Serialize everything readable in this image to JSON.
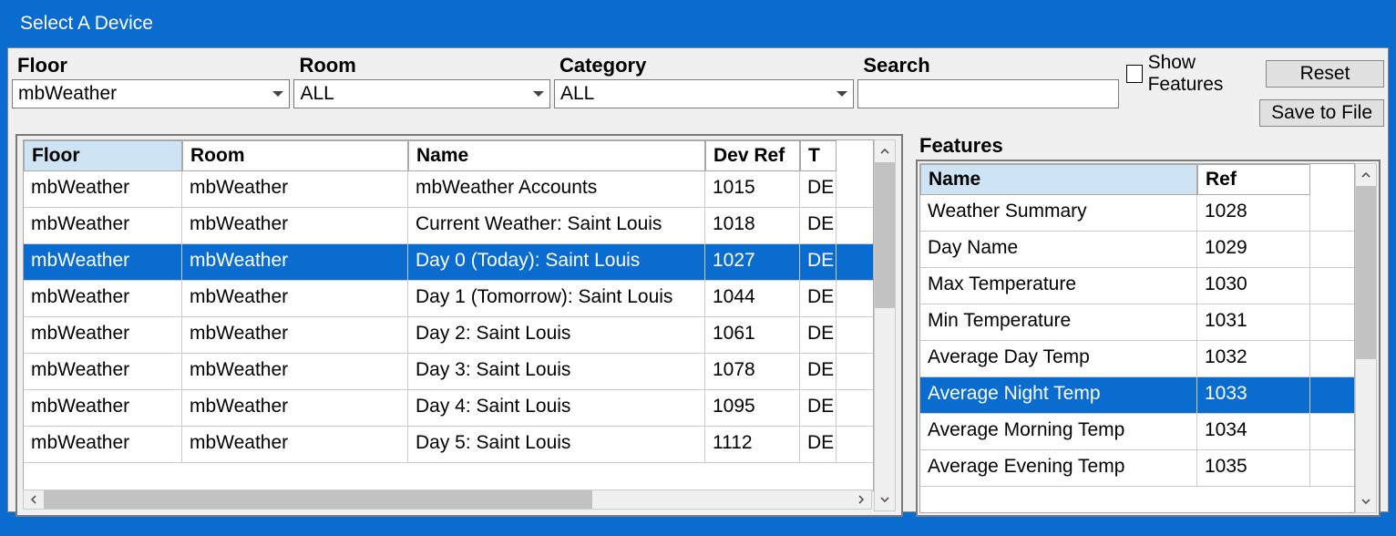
{
  "title": "Select A Device",
  "filters": {
    "floor": {
      "label": "Floor",
      "value": "mbWeather"
    },
    "room": {
      "label": "Room",
      "value": "ALL"
    },
    "category": {
      "label": "Category",
      "value": "ALL"
    },
    "search": {
      "label": "Search",
      "value": ""
    }
  },
  "checkbox": {
    "label": "Show Features",
    "checked": false
  },
  "buttons": {
    "reset": "Reset",
    "save": "Save to File"
  },
  "devices_header": {
    "floor": "Floor",
    "room": "Room",
    "name": "Name",
    "devref": "Dev Ref",
    "t": "T"
  },
  "devices": [
    {
      "floor": "mbWeather",
      "room": "mbWeather",
      "name": "mbWeather Accounts",
      "devref": "1015",
      "t": "DE",
      "selected": false
    },
    {
      "floor": "mbWeather",
      "room": "mbWeather",
      "name": "Current Weather: Saint Louis",
      "devref": "1018",
      "t": "DE",
      "selected": false
    },
    {
      "floor": "mbWeather",
      "room": "mbWeather",
      "name": "Day 0 (Today): Saint Louis",
      "devref": "1027",
      "t": "DE",
      "selected": true
    },
    {
      "floor": "mbWeather",
      "room": "mbWeather",
      "name": "Day 1 (Tomorrow): Saint Louis",
      "devref": "1044",
      "t": "DE",
      "selected": false
    },
    {
      "floor": "mbWeather",
      "room": "mbWeather",
      "name": "Day 2: Saint Louis",
      "devref": "1061",
      "t": "DE",
      "selected": false
    },
    {
      "floor": "mbWeather",
      "room": "mbWeather",
      "name": "Day 3: Saint Louis",
      "devref": "1078",
      "t": "DE",
      "selected": false
    },
    {
      "floor": "mbWeather",
      "room": "mbWeather",
      "name": "Day 4: Saint Louis",
      "devref": "1095",
      "t": "DE",
      "selected": false
    },
    {
      "floor": "mbWeather",
      "room": "mbWeather",
      "name": "Day 5: Saint Louis",
      "devref": "1112",
      "t": "DE",
      "selected": false
    }
  ],
  "features_label": "Features",
  "features_header": {
    "name": "Name",
    "ref": "Ref"
  },
  "features": [
    {
      "name": "Weather Summary",
      "ref": "1028",
      "selected": false
    },
    {
      "name": "Day Name",
      "ref": "1029",
      "selected": false
    },
    {
      "name": "Max Temperature",
      "ref": "1030",
      "selected": false
    },
    {
      "name": "Min Temperature",
      "ref": "1031",
      "selected": false
    },
    {
      "name": "Average Day Temp",
      "ref": "1032",
      "selected": false
    },
    {
      "name": "Average Night Temp",
      "ref": "1033",
      "selected": true
    },
    {
      "name": "Average Morning Temp",
      "ref": "1034",
      "selected": false
    },
    {
      "name": "Average Evening Temp",
      "ref": "1035",
      "selected": false
    }
  ]
}
